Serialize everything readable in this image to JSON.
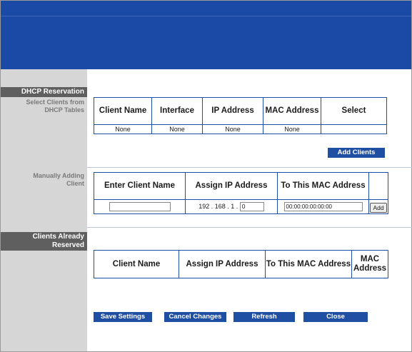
{
  "sidebar": {
    "dhcp_header": "DHCP Reservation",
    "select_clients_label": "Select Clients from DHCP Tables",
    "manual_label": "Manually Adding Client",
    "reserved_header": "Clients Already Reserved"
  },
  "dhcp_table": {
    "headers": [
      "Client Name",
      "Interface",
      "IP Address",
      "MAC Address",
      "Select"
    ],
    "row": [
      "None",
      "None",
      "None",
      "None",
      ""
    ]
  },
  "add_clients_button": "Add Clients",
  "manual_table": {
    "headers": [
      "Enter Client Name",
      "Assign IP Address",
      "To This MAC Address",
      ""
    ],
    "client_name_value": "",
    "ip_prefix": "192 . 168 . 1 .",
    "ip_last_octet": "0",
    "mac_value": "00:00:00:00:00:00",
    "add_button": "Add"
  },
  "reserved_table": {
    "headers": [
      "Client Name",
      "Assign IP Address",
      "To This MAC Address",
      "MAC Address"
    ]
  },
  "actions": {
    "save": "Save Settings",
    "cancel": "Cancel Changes",
    "refresh": "Refresh",
    "close": "Close"
  },
  "colors": {
    "banner": "#1a49a6",
    "button": "#1f4fa3",
    "section_header": "#5f5f5f",
    "sidebar": "#d6d6d6"
  }
}
